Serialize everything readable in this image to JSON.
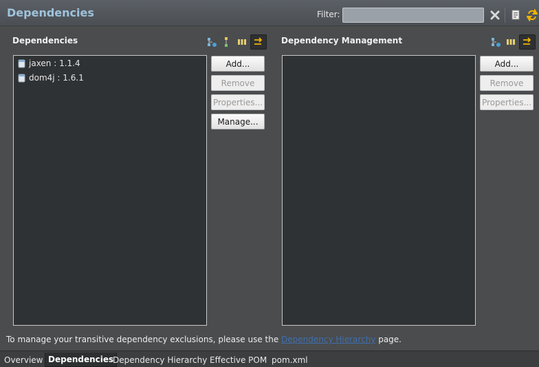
{
  "header": {
    "title": "Dependencies",
    "filter_label": "Filter:",
    "filter_value": "",
    "filter_placeholder": ""
  },
  "dependencies": {
    "title": "Dependencies",
    "items": [
      {
        "label": "jaxen : 1.1.4"
      },
      {
        "label": "dom4j : 1.6.1"
      }
    ],
    "buttons": {
      "add": "Add...",
      "remove": "Remove",
      "properties": "Properties...",
      "manage": "Manage..."
    }
  },
  "management": {
    "title": "Dependency Management",
    "items": [],
    "buttons": {
      "add": "Add...",
      "remove": "Remove",
      "properties": "Properties..."
    }
  },
  "footer": {
    "text_before": "To manage your transitive dependency exclusions, please use the ",
    "link": "Dependency Hierarchy",
    "text_after": " page."
  },
  "tabs": [
    {
      "label": "Overview"
    },
    {
      "label": "Dependencies"
    },
    {
      "label": "Dependency Hierarchy"
    },
    {
      "label": "Effective POM"
    },
    {
      "label": "pom.xml"
    }
  ],
  "colors": {
    "title": "#9fc3dc",
    "panel_bg": "#4a4c4e",
    "list_bg": "#2f3234",
    "link": "#3e6fb0"
  },
  "icons": [
    "clear-filter-icon",
    "save-icon",
    "refresh-icon",
    "add-dependency-icon",
    "tree-icon",
    "columns-icon",
    "sort-icon",
    "jar-icon"
  ]
}
